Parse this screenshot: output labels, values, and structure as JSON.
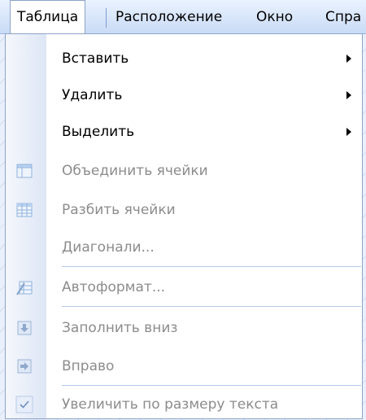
{
  "menubar": {
    "items": [
      "Таблица",
      "Расположение",
      "Окно",
      "Спра"
    ]
  },
  "menu": {
    "items": [
      {
        "label": "Вставить",
        "enabled": true,
        "submenu": true
      },
      {
        "label": "Удалить",
        "enabled": true,
        "submenu": true
      },
      {
        "label": "Выделить",
        "enabled": true,
        "submenu": true
      },
      {
        "label": "Объединить ячейки",
        "enabled": false,
        "icon": "merge-cells-icon"
      },
      {
        "label": "Разбить ячейки",
        "enabled": false,
        "icon": "split-cells-icon"
      },
      {
        "label": "Диагонали...",
        "enabled": false
      },
      {
        "label": "Автоформат...",
        "enabled": false,
        "icon": "autoformat-icon"
      },
      {
        "label": "Заполнить вниз",
        "enabled": false,
        "icon": "fill-down-icon"
      },
      {
        "label": "Вправо",
        "enabled": false,
        "icon": "fill-right-icon"
      },
      {
        "label": "Увеличить по размеру текста",
        "enabled": false,
        "icon": "checkmark-icon"
      }
    ]
  },
  "colors": {
    "enabled_text": "#000000",
    "disabled_text": "#8c8c8c",
    "menubar_bg": "#c9dbf6",
    "gutter_bg": "#dde6f5"
  }
}
